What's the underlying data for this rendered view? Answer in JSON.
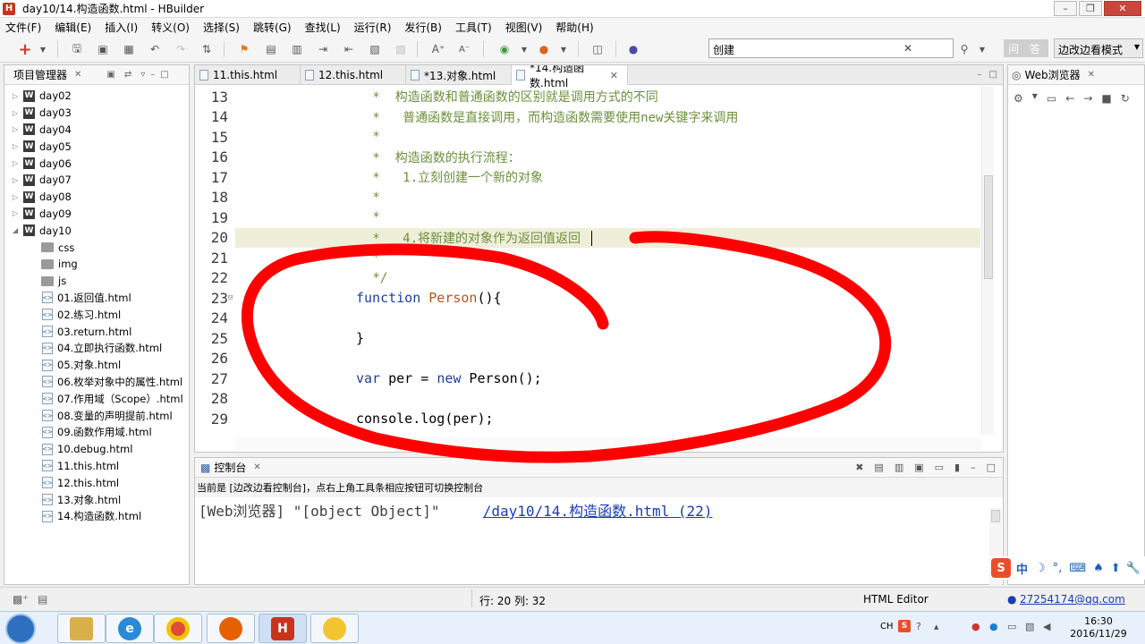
{
  "window": {
    "title": "day10/14.构造函数.html  -  HBuilder",
    "app_icon": "H"
  },
  "menu": [
    "文件(F)",
    "编辑(E)",
    "插入(I)",
    "转义(O)",
    "选择(S)",
    "跳转(G)",
    "查找(L)",
    "运行(R)",
    "发行(B)",
    "工具(T)",
    "视图(V)",
    "帮助(H)"
  ],
  "toolbar": {
    "search_value": "创建",
    "wenda_label": "问 答",
    "mode_label": "边改边看模式"
  },
  "project_panel": {
    "title": "项目管理器",
    "items": [
      {
        "label": "day02",
        "type": "project",
        "expanded": false
      },
      {
        "label": "day03",
        "type": "project",
        "expanded": false
      },
      {
        "label": "day04",
        "type": "project",
        "expanded": false
      },
      {
        "label": "day05",
        "type": "project",
        "expanded": false
      },
      {
        "label": "day06",
        "type": "project",
        "expanded": false
      },
      {
        "label": "day07",
        "type": "project",
        "expanded": false
      },
      {
        "label": "day08",
        "type": "project",
        "expanded": false
      },
      {
        "label": "day09",
        "type": "project",
        "expanded": false
      },
      {
        "label": "day10",
        "type": "project",
        "expanded": true
      },
      {
        "label": "css",
        "type": "folder"
      },
      {
        "label": "img",
        "type": "folder"
      },
      {
        "label": "js",
        "type": "folder"
      },
      {
        "label": "01.返回值.html",
        "type": "file"
      },
      {
        "label": "02.练习.html",
        "type": "file"
      },
      {
        "label": "03.return.html",
        "type": "file"
      },
      {
        "label": "04.立即执行函数.html",
        "type": "file"
      },
      {
        "label": "05.对象.html",
        "type": "file"
      },
      {
        "label": "06.枚举对象中的属性.html",
        "type": "file"
      },
      {
        "label": "07.作用域（Scope）.html",
        "type": "file"
      },
      {
        "label": "08.变量的声明提前.html",
        "type": "file"
      },
      {
        "label": "09.函数作用域.html",
        "type": "file"
      },
      {
        "label": "10.debug.html",
        "type": "file"
      },
      {
        "label": "11.this.html",
        "type": "file"
      },
      {
        "label": "12.this.html",
        "type": "file"
      },
      {
        "label": "13.对象.html",
        "type": "file"
      },
      {
        "label": "14.构造函数.html",
        "type": "file"
      }
    ]
  },
  "editor": {
    "tabs": [
      "11.this.html",
      "12.this.html",
      "*13.对象.html",
      "*14.构造函数.html"
    ],
    "active_tab": "*14.构造函数.html",
    "current_line": "20",
    "lines": [
      {
        "n": "13",
        "text": " *  构造函数和普通函数的区别就是调用方式的不同"
      },
      {
        "n": "14",
        "text": " *   普通函数是直接调用，而构造函数需要使用new关键字来调用"
      },
      {
        "n": "15",
        "text": " *"
      },
      {
        "n": "16",
        "text": " *  构造函数的执行流程："
      },
      {
        "n": "17",
        "text": " *   1.立刻创建一个新的对象"
      },
      {
        "n": "18",
        "text": " *"
      },
      {
        "n": "19",
        "text": " *"
      },
      {
        "n": "20",
        "text": " *   4.将新建的对象作为返回值返回"
      },
      {
        "n": "21",
        "text": " *"
      },
      {
        "n": "22",
        "text": " */"
      },
      {
        "n": "23",
        "text": "function Person(){"
      },
      {
        "n": "24",
        "text": ""
      },
      {
        "n": "25",
        "text": "}"
      },
      {
        "n": "26",
        "text": ""
      },
      {
        "n": "27",
        "text": "var per = new Person();"
      },
      {
        "n": "28",
        "text": ""
      },
      {
        "n": "29",
        "text": "console.log(per);"
      }
    ]
  },
  "console": {
    "title": "控制台",
    "info": "当前是 [边改边看控制台]，点右上角工具条相应按钮可切换控制台",
    "output_prefix": "[Web浏览器] \"[object Object]\"",
    "output_link": "/day10/14.构造函数.html (22)"
  },
  "web_panel": {
    "title": "Web浏览器"
  },
  "statusbar": {
    "position": "行: 20 列: 32",
    "editor_type": "HTML Editor",
    "user": "27254174@qq.com"
  },
  "taskbar": {
    "ime": "CH",
    "time": "16:30",
    "date": "2016/11/29"
  },
  "ime_bar": {
    "label": "中"
  },
  "colors": {
    "annotation": "#ff0000",
    "comment": "#6d8f3d",
    "keyword": "#1f3f9f",
    "function_name": "#b5551e",
    "current_line": "#efeed9"
  }
}
